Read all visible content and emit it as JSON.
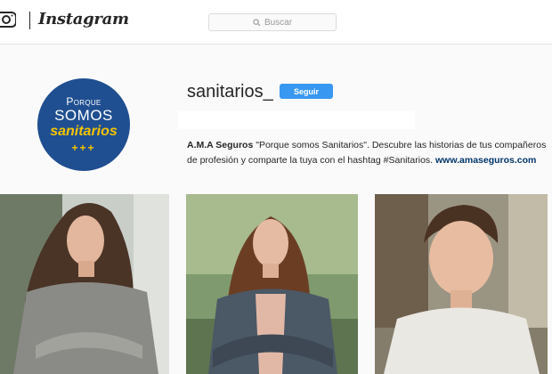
{
  "header": {
    "logo_text": "Instagram",
    "search_placeholder": "Buscar"
  },
  "profile": {
    "username": "sanitarios_",
    "follow_label": "Seguir",
    "avatar": {
      "line1": "Porque",
      "line2": "SOMOS",
      "line3": "sanitarios",
      "plus_signs": "+++"
    },
    "bio": {
      "name": "A.M.A Seguros",
      "text": " \"Porque somos Sanitarios\". Descubre las historias de tus compañeros de profesión y comparte la tuya con el hashtag #Sanitarios. ",
      "link": "www.amaseguros.com"
    }
  },
  "colors": {
    "follow_button": "#3897f0",
    "avatar_bg": "#1f4f90",
    "avatar_accent": "#f5c400",
    "link": "#003569"
  },
  "icons": [
    "instagram-camera-icon",
    "search-icon"
  ]
}
